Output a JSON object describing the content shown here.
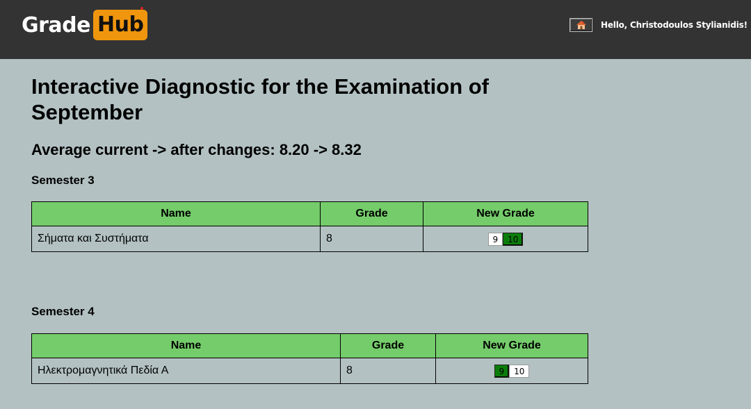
{
  "header": {
    "logo_left": "Grade",
    "logo_right": "Hub",
    "home_icon": "house-icon",
    "greeting": "Hello, Christodoulos Stylianidis!"
  },
  "page": {
    "title": "Interactive Diagnostic for the Examination of September",
    "average": "Average current -> after changes: 8.20 -> 8.32"
  },
  "semesters": [
    {
      "title": "Semester 3",
      "columns": [
        "Name",
        "Grade",
        "New Grade"
      ],
      "rows": [
        {
          "name": "Σήματα και Συστήματα",
          "grade": "8",
          "options": [
            "9",
            "10"
          ],
          "selected": "10"
        }
      ]
    },
    {
      "title": "Semester 4",
      "columns": [
        "Name",
        "Grade",
        "New Grade"
      ],
      "rows": [
        {
          "name": "Ηλεκτρομαγνητικά Πεδία Α",
          "grade": "8",
          "options": [
            "9",
            "10"
          ],
          "selected": "9"
        }
      ]
    }
  ],
  "colors": {
    "topbar": "#333333",
    "background": "#b3c1c2",
    "table_header": "#74cc6a",
    "selected_grade": "#0b7d0b",
    "logo_accent": "#f0960e"
  }
}
